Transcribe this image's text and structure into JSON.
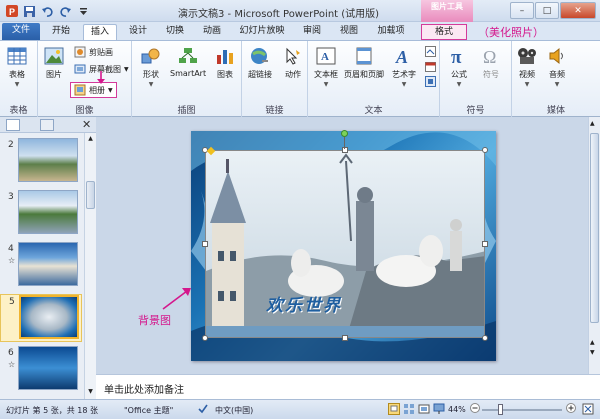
{
  "app": {
    "title": "演示文稿3 - Microsoft PowerPoint (试用版)",
    "context_group_label": "图片工具",
    "window_controls": {
      "minimize": "–",
      "maximize": "□",
      "close": "✕"
    }
  },
  "tabs": [
    {
      "label": "文件",
      "kind": "file"
    },
    {
      "label": "开始",
      "kind": "normal"
    },
    {
      "label": "插入",
      "kind": "active"
    },
    {
      "label": "设计",
      "kind": "normal"
    },
    {
      "label": "切换",
      "kind": "normal"
    },
    {
      "label": "动画",
      "kind": "normal"
    },
    {
      "label": "幻灯片放映",
      "kind": "normal"
    },
    {
      "label": "审阅",
      "kind": "normal"
    },
    {
      "label": "视图",
      "kind": "normal"
    },
    {
      "label": "加载项",
      "kind": "normal"
    },
    {
      "label": "格式",
      "kind": "contextual"
    }
  ],
  "annotations": {
    "format_tab_note": "（美化照片）",
    "background_note": "背景图"
  },
  "ribbon": {
    "groups": {
      "table": "表格",
      "image": "图像",
      "illustration": "插图",
      "link": "链接",
      "text": "文本",
      "symbol": "符号",
      "media": "媒体"
    },
    "buttons": {
      "table": "表格",
      "picture": "图片",
      "clipart": "剪贴画",
      "screenshot": "屏幕截图",
      "album": "相册",
      "shapes": "形状",
      "smartart": "SmartArt",
      "chart": "图表",
      "hyperlink": "超链接",
      "action": "动作",
      "textbox": "文本框",
      "header_footer": "页眉和页脚",
      "wordart": "艺术字",
      "formula": "公式",
      "symbol": "符号",
      "video": "视频",
      "audio": "音频"
    }
  },
  "panel": {
    "slides": [
      {
        "number": "2",
        "has_transition": false
      },
      {
        "number": "3",
        "has_transition": false
      },
      {
        "number": "4",
        "has_transition": true
      },
      {
        "number": "5",
        "has_transition": false,
        "selected": true
      },
      {
        "number": "6",
        "has_transition": true
      }
    ],
    "transition_mark": "☆",
    "close": "✕"
  },
  "slide": {
    "photo_caption": "欢乐世界"
  },
  "notes": {
    "placeholder": "单击此处添加备注"
  },
  "status": {
    "slide_info": "幻灯片 第 5 张，共 18 张",
    "theme": "\"Office 主题\"",
    "language": "中文(中国)",
    "zoom": "44%"
  },
  "colors": {
    "accent_magenta": "#d4178c",
    "file_tab": "#2a5fa8",
    "ribbon_bg": "#e5edf7"
  }
}
